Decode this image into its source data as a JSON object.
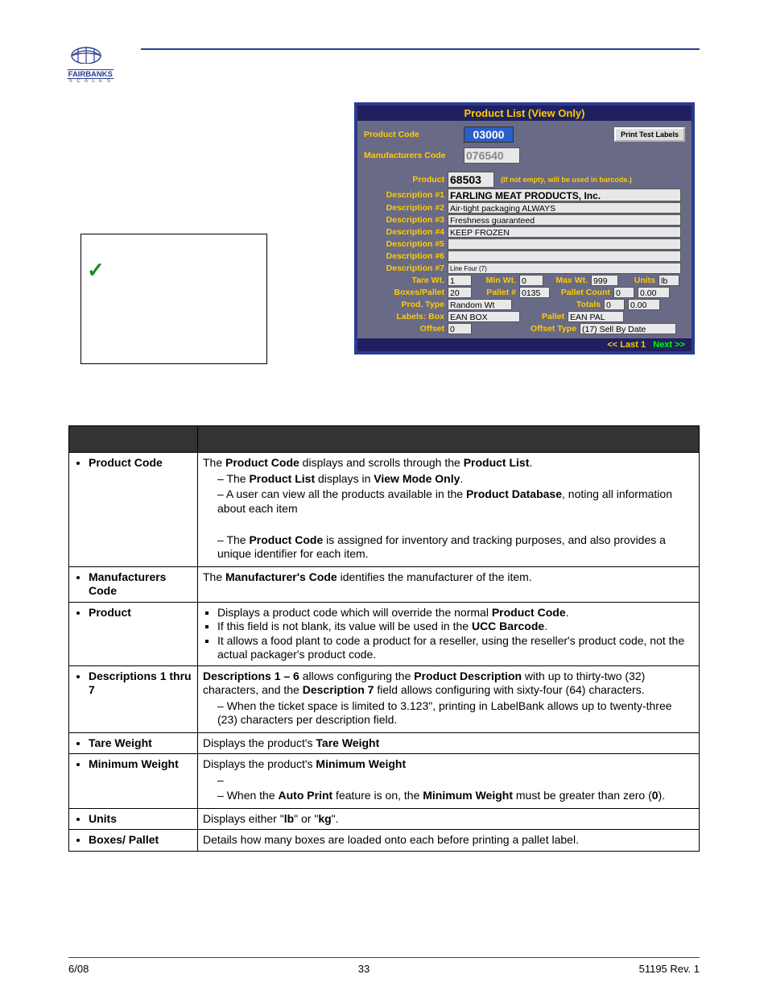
{
  "header": {
    "brand": "FAIRBANKS"
  },
  "screenshot": {
    "title": "Product List (View Only)",
    "product_code_label": "Product Code",
    "product_code": "03000",
    "print_btn": "Print Test Labels",
    "mfg_label": "Manufacturers Code",
    "mfg_code": "076540",
    "product_label": "Product",
    "product": "68503",
    "barcode_note": "(If not empty, will be used in barcode.)",
    "desc_labels": [
      "Description #1",
      "Description #2",
      "Description #3",
      "Description #4",
      "Description #5",
      "Description #6",
      "Description #7"
    ],
    "desc_values": [
      "FARLING MEAT PRODUCTS, Inc.",
      "Air-tight packaging ALWAYS",
      "Freshness guaranteed",
      "KEEP FROZEN",
      "",
      "",
      "Line Four (7)"
    ],
    "tare_label": "Tare Wt.",
    "tare": "1",
    "min_label": "Min Wt.",
    "min": "0",
    "max_label": "Max Wt.",
    "max": "999",
    "units_label": "Units",
    "units": "lb",
    "boxes_label": "Boxes/Pallet",
    "boxes": "20",
    "palletn_label": "Pallet #",
    "palletn": "0135",
    "pcount_label": "Pallet Count",
    "pcount": "0",
    "pcount2": "0.00",
    "ptype_label": "Prod. Type",
    "ptype": "Random Wt",
    "totals_label": "Totals",
    "totals": "0",
    "totals2": "0.00",
    "lbox_label": "Labels: Box",
    "lbox": "EAN BOX",
    "pallet_label": "Pallet",
    "pallet": "EAN PAL",
    "offset_label": "Offset",
    "offset": "0",
    "otype_label": "Offset Type",
    "otype": "(17) Sell By Date",
    "nav_last": "<< Last 1",
    "nav_next": "Next >>"
  },
  "table": {
    "rows": [
      {
        "topic": "Product Code",
        "body": "The <b>Product Code</b> displays and scrolls through the <b>Product List</b>.<ul class='dash'><li>The <b>Product List</b> displays in <b>View Mode Only</b>.</li><li>A user can view all the products available in the <b>Product Database</b>, noting all information about each item</li></ul><br><ul class='dash'><li>The <b>Product Code</b> is assigned for inventory and tracking purposes, and also provides a unique identifier for each item.</li></ul>"
      },
      {
        "topic": "Manufacturers Code",
        "body": "The <b>Manufacturer's Code</b> identifies the manufacturer of the item."
      },
      {
        "topic": "Product",
        "body": "<ul class='square'><li>Displays a product code which will override the normal <b>Product Code</b>.</li><li>If this field is not blank, its value will be used in the <b>UCC Barcode</b>.</li><li>It allows a food plant to code a product for a reseller, using the reseller's product code, not the actual packager's product code.</li></ul>"
      },
      {
        "topic": "Descriptions 1 thru 7",
        "body": "<b>Descriptions 1 – 6</b> allows configuring the <b>Product Description</b> with up to thirty-two (32) characters, and the <b>Description 7</b> field allows configuring with sixty-four (64) characters.<ul class='dash'><li>When the ticket space is limited to 3.123\", printing in LabelBank allows up to twenty-three (23) characters per description field.</li></ul>"
      },
      {
        "topic": "Tare Weight",
        "body": "Displays the product's <b>Tare Weight</b>"
      },
      {
        "topic": "Minimum Weight",
        "body": "Displays the product's <b>Minimum Weight</b><ul class='dash'><li><br></li><li>When the <b>Auto Print</b> feature is on, the <b>Minimum Weight</b> must be greater than zero (<b>0</b>).</li></ul>"
      },
      {
        "topic": "Units",
        "body": "Displays either \"<b>lb</b>\" or \"<b>kg</b>\"."
      },
      {
        "topic": "Boxes/ Pallet",
        "body": "Details how many boxes are loaded onto each before printing a pallet label."
      }
    ]
  },
  "footer": {
    "left": "6/08",
    "center": "33",
    "right": "51195    Rev. 1"
  }
}
